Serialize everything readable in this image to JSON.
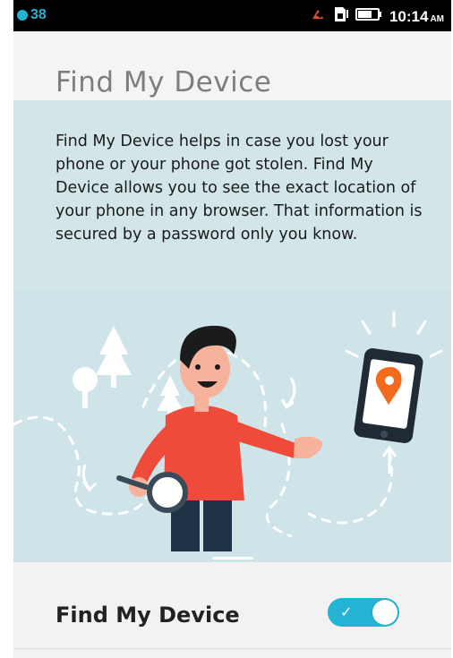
{
  "status_bar": {
    "notification_count": "38",
    "time": "10:14",
    "ampm": "AM",
    "icons": [
      "notification-dot-icon",
      "missed-call-icon",
      "sim-icon",
      "battery-icon"
    ]
  },
  "header": {
    "title": "Find My Device"
  },
  "description": "Find My Device helps in case you lost your phone or your phone got stolen. Find My Device allows you to see the exact location of your phone in any browser. That information is secured by a password only you know.",
  "setting": {
    "label": "Find My Device",
    "enabled": true
  },
  "colors": {
    "accent": "#25b3d3",
    "panel": "#d2e5e8",
    "header_bg": "#f4f4f4",
    "shirt": "#ef4b3a",
    "pin": "#f26a1b"
  }
}
